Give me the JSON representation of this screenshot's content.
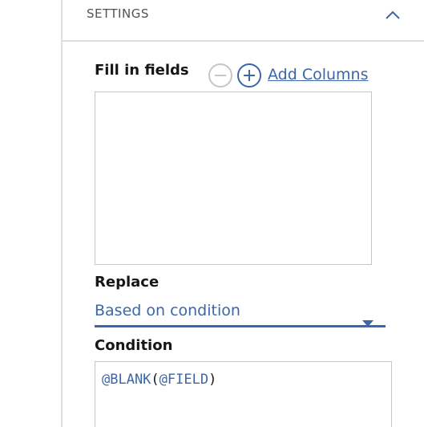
{
  "settings": {
    "title": "SETTINGS",
    "collapse_icon": "chevron-up-icon"
  },
  "fill_in_fields": {
    "label": "Fill in fields",
    "remove_icon": "minus-circle-icon",
    "add_icon": "plus-circle-icon",
    "add_columns_label": "Add Columns",
    "fields": []
  },
  "replace": {
    "label": "Replace",
    "selected": "Based on condition",
    "caret_icon": "caret-down-icon"
  },
  "condition": {
    "label": "Condition",
    "func": "@BLANK",
    "open_paren": "(",
    "arg": "@FIELD",
    "close_paren": ")"
  },
  "colors": {
    "accent": "#3b66a8",
    "text": "#161616",
    "muted": "#525252",
    "border": "#c6c6c6",
    "disabled": "#c6c6c6"
  }
}
